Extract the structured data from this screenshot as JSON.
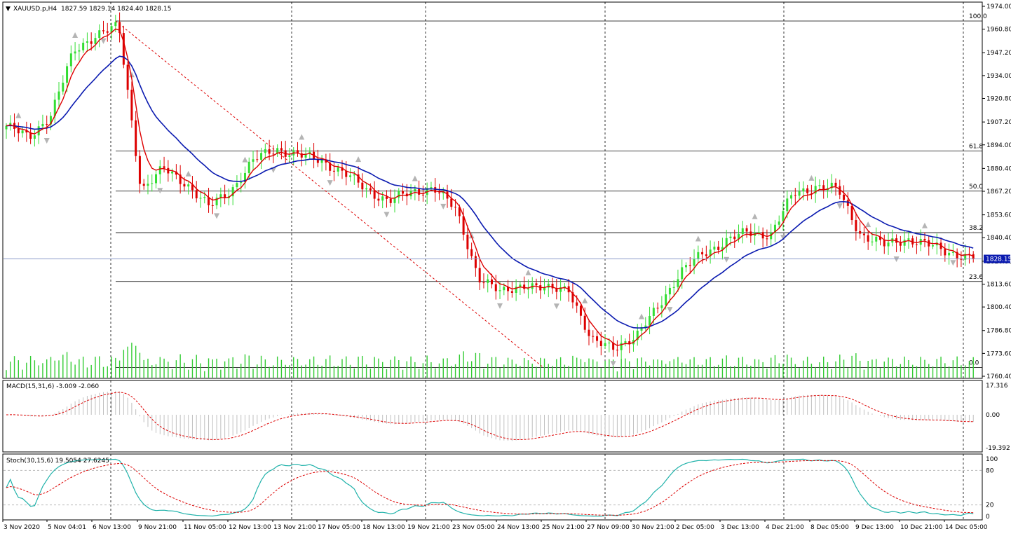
{
  "header": {
    "symbol": "XAUUSD.p,H4",
    "ohlc": "1827.59 1829.14 1824.40 1828.15"
  },
  "colors": {
    "bull": "#33dd33",
    "bear": "#dd0000",
    "ma_fast": "#dd0000",
    "ma_slow": "#0a1ab0",
    "grid": "#000000",
    "fractal": "#b4b4b4",
    "volume": "#33cc33",
    "macd_hist": "#c0c0c0",
    "signal": "#dd0000",
    "stoch_main": "#20b2aa",
    "current_price_bg": "#0a1ab0"
  },
  "price_axis": {
    "ticks": [
      "1974.00",
      "1960.80",
      "1947.20",
      "1934.00",
      "1920.80",
      "1907.20",
      "1894.00",
      "1880.40",
      "1867.20",
      "1853.60",
      "1840.40",
      "1826.80",
      "1813.60",
      "1800.40",
      "1786.80",
      "1773.60",
      "1760.40"
    ],
    "current": "1828.15"
  },
  "time_axis": {
    "labels": [
      "3 Nov 2020",
      "5 Nov 04:01",
      "6 Nov 13:00",
      "9 Nov 21:00",
      "11 Nov 05:00",
      "12 Nov 13:00",
      "13 Nov 21:00",
      "17 Nov 05:00",
      "18 Nov 13:00",
      "19 Nov 21:00",
      "23 Nov 05:00",
      "24 Nov 13:00",
      "25 Nov 21:00",
      "27 Nov 09:00",
      "30 Nov 21:00",
      "2 Dec 05:00",
      "3 Dec 13:00",
      "4 Dec 21:00",
      "8 Dec 05:00",
      "9 Dec 13:00",
      "10 Dec 21:00",
      "14 Dec 05:00"
    ]
  },
  "fibo": {
    "levels": [
      "100.0",
      "61.8",
      "50.0",
      "38.2",
      "23.6",
      "0.0"
    ]
  },
  "macd": {
    "label": "MACD(15,31,6) -3.009 -2.060",
    "ticks": [
      "17.316",
      "0.00",
      "-19.392"
    ]
  },
  "stoch": {
    "label": "Stoch(30,15,6) 19.5054 27.6245",
    "ticks": [
      "100",
      "80",
      "20",
      "0"
    ]
  },
  "chart_data": {
    "type": "candlestick",
    "symbol": "XAUUSD.p",
    "timeframe": "H4",
    "ylim": [
      1760.4,
      1974.0
    ],
    "x_start": "3 Nov 2020",
    "x_end": "14 Dec 05:00",
    "close_anchors": [
      1905,
      1898,
      1912,
      1948,
      1958,
      1962,
      1868,
      1880,
      1872,
      1858,
      1868,
      1885,
      1892,
      1888,
      1885,
      1878,
      1868,
      1862,
      1866,
      1870,
      1856,
      1818,
      1808,
      1814,
      1810,
      1812,
      1780,
      1778,
      1782,
      1802,
      1820,
      1832,
      1838,
      1844,
      1842,
      1866,
      1870,
      1868,
      1842,
      1836,
      1840,
      1836,
      1832,
      1828.15
    ],
    "fibonacci_retracement": [
      {
        "level": "100.0",
        "price": 1965.5
      },
      {
        "level": "61.8",
        "price": 1890.5
      },
      {
        "level": "50.0",
        "price": 1867.3
      },
      {
        "level": "38.2",
        "price": 1843.3
      },
      {
        "level": "23.6",
        "price": 1815.1
      },
      {
        "level": "0.0",
        "price": 1765.5
      }
    ],
    "macd": {
      "params": "15,31,6",
      "main": -3.009,
      "signal": -2.06,
      "ylim": [
        -19.392,
        17.316
      ]
    },
    "stochastic": {
      "params": "30,15,6",
      "main": 19.5054,
      "signal": 27.6245,
      "levels": [
        20,
        80
      ],
      "ylim": [
        0,
        100
      ]
    }
  }
}
